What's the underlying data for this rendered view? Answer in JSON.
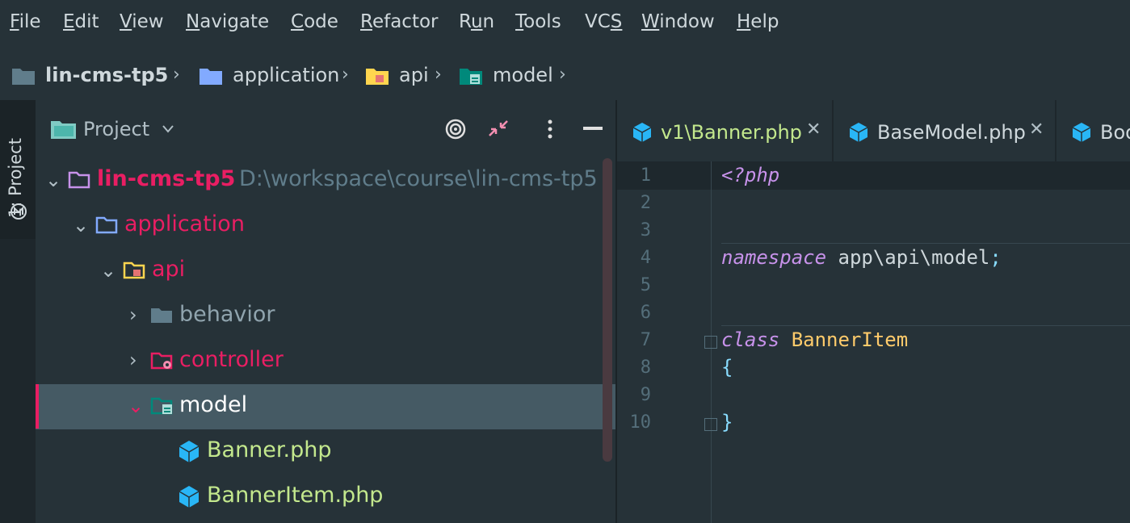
{
  "menu": [
    "File",
    "Edit",
    "View",
    "Navigate",
    "Code",
    "Refactor",
    "Run",
    "Tools",
    "VCS",
    "Window",
    "Help"
  ],
  "menu_underline": [
    "F",
    "E",
    "V",
    "N",
    "C",
    "R",
    "u",
    "T",
    "S",
    "W",
    "H"
  ],
  "breadcrumb": {
    "project": "lin-cms-tp5",
    "p1": "application",
    "p2": "api",
    "p3": "model"
  },
  "sidebar": {
    "vertical_tab": "1: Project"
  },
  "panel": {
    "title": "Project"
  },
  "tree": {
    "root": "lin-cms-tp5",
    "root_path": "D:\\workspace\\course\\lin-cms-tp5",
    "application": "application",
    "api": "api",
    "behavior": "behavior",
    "controller": "controller",
    "model": "model",
    "file1": "Banner.php",
    "file2": "BannerItem.php"
  },
  "tabs": [
    "v1\\Banner.php",
    "BaseModel.php",
    "Boo"
  ],
  "line_numbers": [
    "1",
    "2",
    "3",
    "4",
    "5",
    "6",
    "7",
    "8",
    "9",
    "10"
  ],
  "code": {
    "l1": "<?php",
    "l4_kw": "namespace",
    "l4_rest": " app\\api\\model",
    "l4_semi": ";",
    "l7_kw": "class",
    "l7_name": " BannerItem",
    "l8": "{",
    "l10": "}"
  },
  "colors": {
    "accent": "#e91e63",
    "keyword": "#c792ea",
    "classname": "#ffcb6b",
    "brace": "#89ddff",
    "file": "#c3e88d"
  }
}
